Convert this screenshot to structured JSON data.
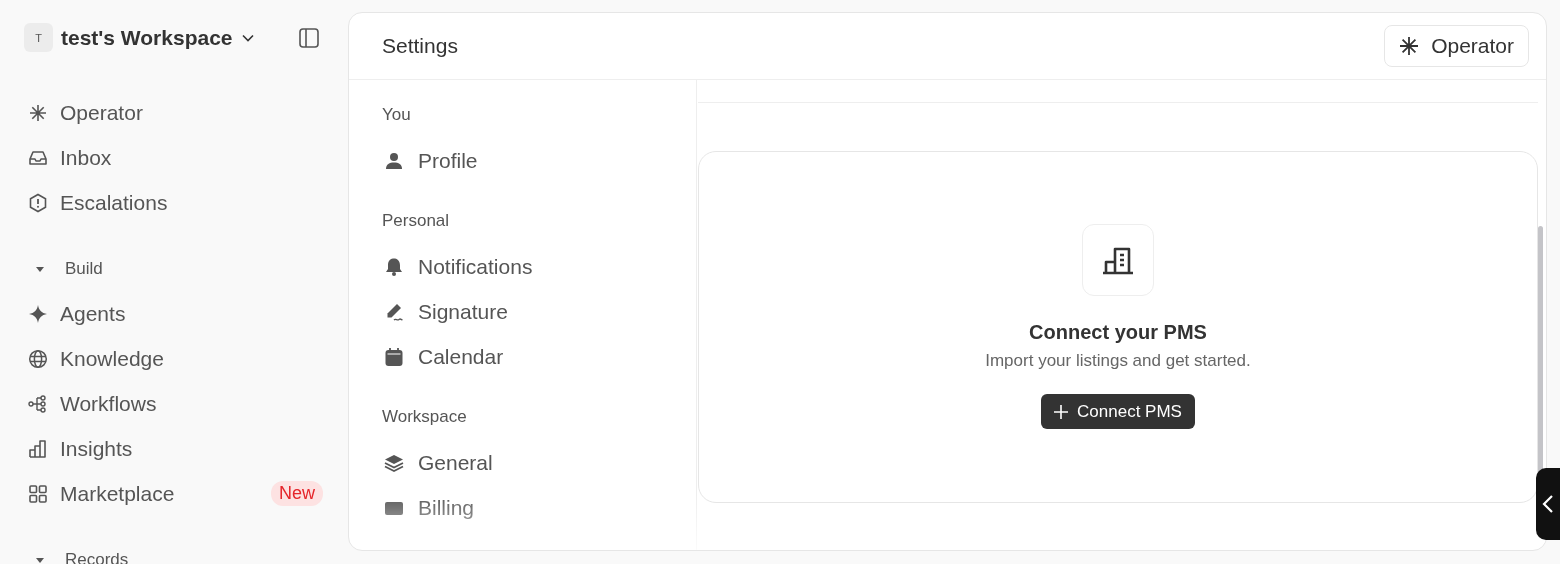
{
  "workspace": {
    "initial": "T",
    "name": "test's Workspace"
  },
  "sidebar": {
    "items": [
      {
        "label": "Operator",
        "selected": false
      },
      {
        "label": "Inbox",
        "selected": false
      },
      {
        "label": "Escalations",
        "selected": false
      }
    ],
    "groups": [
      {
        "title": "Build",
        "expanded": true,
        "items": [
          {
            "label": "Agents",
            "selected": false
          },
          {
            "label": "Knowledge",
            "selected": false
          },
          {
            "label": "Workflows",
            "selected": false
          },
          {
            "label": "Insights",
            "selected": false
          },
          {
            "label": "Marketplace",
            "selected": false,
            "badge": "New"
          }
        ]
      },
      {
        "title": "Records",
        "expanded": true
      }
    ]
  },
  "header": {
    "title": "Settings",
    "button": "Operator"
  },
  "settings_nav": [
    {
      "title": "You",
      "items": [
        {
          "label": "Profile",
          "selected": false
        }
      ]
    },
    {
      "title": "Personal",
      "items": [
        {
          "label": "Notifications",
          "selected": false
        },
        {
          "label": "Signature",
          "selected": false
        },
        {
          "label": "Calendar",
          "selected": false
        }
      ]
    },
    {
      "title": "Workspace",
      "items": [
        {
          "label": "General",
          "selected": false
        },
        {
          "label": "Billing",
          "selected": false
        }
      ]
    }
  ],
  "empty_state": {
    "title": "Connect your PMS",
    "text": "Import your listings and get started.",
    "button": "Connect PMS"
  }
}
